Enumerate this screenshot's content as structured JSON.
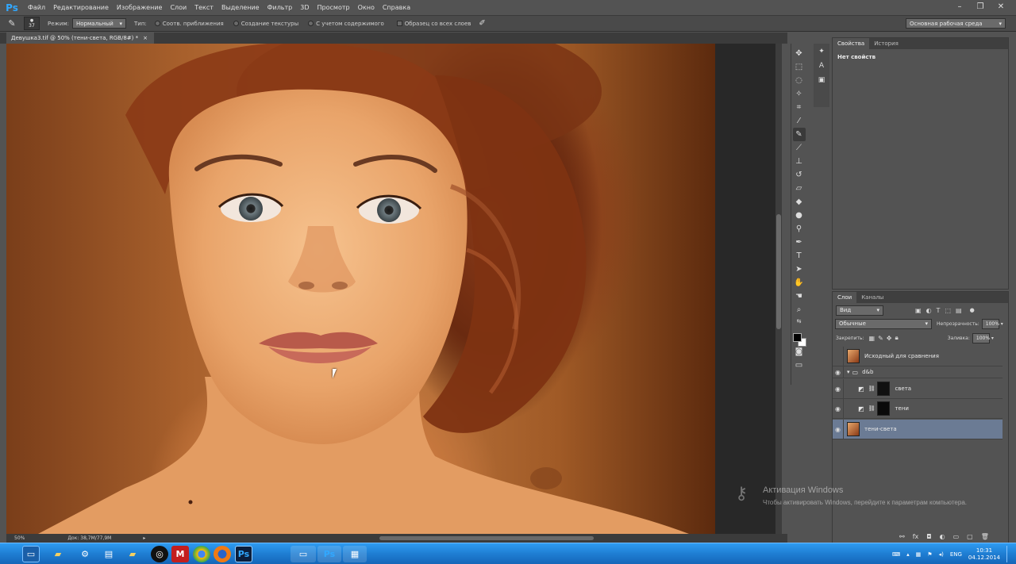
{
  "app": {
    "logo": "Ps"
  },
  "menu": [
    "Файл",
    "Редактирование",
    "Изображение",
    "Слои",
    "Текст",
    "Выделение",
    "Фильтр",
    "3D",
    "Просмотр",
    "Окно",
    "Справка"
  ],
  "window_controls": {
    "minimize": "–",
    "maximize": "❐",
    "close": "✕"
  },
  "options": {
    "brush_size": "37",
    "mode_label": "Режим:",
    "mode_value": "Нормальный",
    "type_label": "Тип:",
    "radio_1": "Соотв. приближения",
    "radio_2": "Создание текстуры",
    "radio_3": "С учетом содержимого",
    "sample_all": "Образец со всех слоев",
    "workspace": "Основная рабочая среда"
  },
  "document": {
    "tab_title": "Девушка3.tif @ 50% (тени-света, RGB/8#) *",
    "close": "×"
  },
  "status": {
    "zoom": "50%",
    "doc_info": "Док: 38,7M/77,9M"
  },
  "properties_panel": {
    "tab_properties": "Свойства",
    "tab_history": "История",
    "body": "Нет свойств"
  },
  "layers_panel": {
    "tab_layers": "Слои",
    "tab_channels": "Каналы",
    "filter": "Вид",
    "blend_mode": "Обычные",
    "opacity_label": "Непрозрачность:",
    "opacity_value": "100%",
    "lock_label": "Закрепить:",
    "fill_label": "Заливка:",
    "fill_value": "100%",
    "layers": [
      {
        "name": "Исходный для сравнения",
        "visible": false
      },
      {
        "name": "d&b",
        "visible": true
      },
      {
        "name": "света",
        "visible": true
      },
      {
        "name": "тени",
        "visible": true
      },
      {
        "name": "тени-света",
        "visible": true
      }
    ]
  },
  "watermark": {
    "title": "Активация Windows",
    "subtitle": "Чтобы активировать Windows, перейдите к параметрам компьютера."
  },
  "taskbar": {
    "lang": "ENG",
    "time": "10:31",
    "date": "04.12.2014"
  },
  "colors": {
    "accent_ps": "#31a8ff",
    "selected_layer": "#6b7b94",
    "taskbar": "#1f7ed3"
  }
}
